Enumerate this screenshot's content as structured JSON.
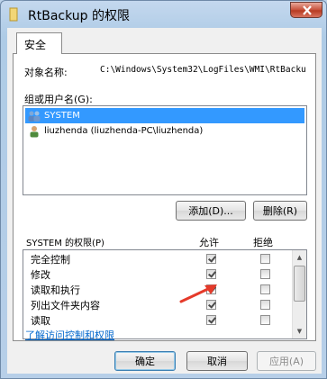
{
  "window": {
    "title": "RtBackup 的权限",
    "title_icon": "folder-icon",
    "close_icon": "close-icon"
  },
  "tab": {
    "label": "安全"
  },
  "object": {
    "label": "对象名称:",
    "value": "C:\\Windows\\System32\\LogFiles\\WMI\\RtBacku"
  },
  "groups": {
    "label": "组或用户名(G):",
    "items": [
      {
        "label": "SYSTEM",
        "icon": "user-group-icon",
        "selected": true
      },
      {
        "label": "liuzhenda (liuzhenda-PC\\liuzhenda)",
        "icon": "user-icon",
        "selected": false
      }
    ]
  },
  "buttons": {
    "add": "添加(D)...",
    "remove": "删除(R)",
    "ok": "确定",
    "cancel": "取消",
    "apply": "应用(A)"
  },
  "permissions": {
    "header": "SYSTEM 的权限(P)",
    "allow_label": "允许",
    "deny_label": "拒绝",
    "rows": [
      {
        "name": "完全控制",
        "allow": true,
        "deny": false
      },
      {
        "name": "修改",
        "allow": true,
        "deny": false
      },
      {
        "name": "读取和执行",
        "allow": true,
        "deny": false
      },
      {
        "name": "列出文件夹内容",
        "allow": true,
        "deny": false
      },
      {
        "name": "读取",
        "allow": true,
        "deny": false
      }
    ]
  },
  "link": {
    "text": "了解访问控制和权限"
  },
  "colors": {
    "annotation_arrow": "#e53a2a",
    "selection": "#3399ff",
    "link": "#0066cc"
  }
}
